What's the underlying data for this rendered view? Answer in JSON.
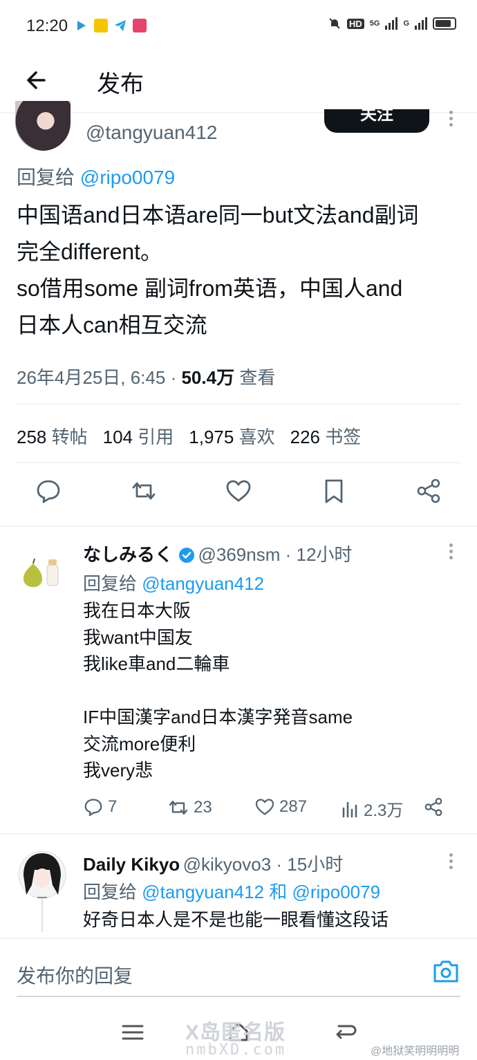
{
  "status_bar": {
    "time": "12:20",
    "network": "5G",
    "network2": "G",
    "hd_label": "HD"
  },
  "header": {
    "back_icon": "arrow-left-icon",
    "title": "发布"
  },
  "main_tweet": {
    "name_partial": "ﾞﾞﾞﾞﾞﾞﾞ",
    "handle": "@tangyuan412",
    "follow_label": "关注",
    "reply_to_prefix": "回复给",
    "reply_to_handle": "@ripo0079",
    "body": "中国语and日本语are同一but文法and副词\n完全different。\nso借用some 副词from英语，中国人and\n日本人can相互交流",
    "timestamp": "26年4月25日, 6:45 · ",
    "views_count": "50.4万",
    "views_label": "查看",
    "stats": {
      "retweets_count": "258",
      "retweets_label": "转帖",
      "quotes_count": "104",
      "quotes_label": "引用",
      "likes_count": "1,975",
      "likes_label": "喜欢",
      "bookmarks_count": "226",
      "bookmarks_label": "书签"
    },
    "actions": [
      "reply-icon",
      "retweet-icon",
      "like-icon",
      "bookmark-icon",
      "share-icon"
    ]
  },
  "replies": [
    {
      "name": "なしみるく",
      "verified": true,
      "handle": "@369nsm",
      "time": " · 12小时",
      "reply_to_prefix": "回复给",
      "reply_to_handle": "@tangyuan412",
      "body": "我在日本大阪\n我want中国友\n我like車and二輪車\n\nIF中国漢字and日本漢字発音same\n交流more便利\n我very悲",
      "reply_count": "7",
      "retweet_count": "23",
      "like_count": "287",
      "view_count": "2.3万"
    },
    {
      "name": "Daily Kikyo",
      "handle": "@kikyovo3",
      "time": " · 15小时",
      "reply_to_prefix": "回复给",
      "reply_to_handle": "@tangyuan412",
      "reply_to_and": " 和 ",
      "reply_to_handle2": "@ripo0079",
      "body": "好奇日本人是不是也能一眼看懂这段话"
    }
  ],
  "compose": {
    "placeholder": "发布你的回复"
  },
  "watermark": {
    "line1": "X岛匿名版",
    "line2": "nmbXD.com",
    "line3": "@地狱笑明明明明"
  },
  "colors": {
    "link": "#1d9bf0",
    "muted": "#536471",
    "text": "#0f1419",
    "divider": "#eff3f4"
  }
}
